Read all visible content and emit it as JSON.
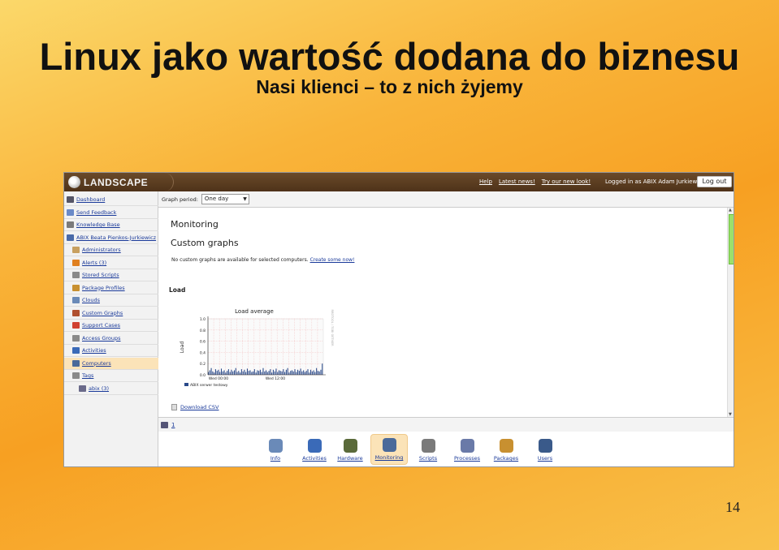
{
  "slide": {
    "title": "Linux jako wartość dodana do biznesu",
    "subtitle": "Nasi klienci – to z nich żyjemy",
    "page_number": "14"
  },
  "app": {
    "logo_text": "LANDSCAPE",
    "top_links": [
      "Help",
      "Latest news!",
      "Try our new look!"
    ],
    "logged_in": "Logged in as ABIX Adam Jurkiewicz",
    "logout_label": "Log out"
  },
  "sidebar": {
    "items": [
      {
        "label": "Dashboard",
        "icon": "dashboard-icon",
        "color": "#556"
      },
      {
        "label": "Send Feedback",
        "icon": "envelope-icon",
        "color": "#6a8ac8"
      },
      {
        "label": "Knowledge Base",
        "icon": "book-icon",
        "color": "#7a7a7a"
      },
      {
        "label": "ABIX Beata Pienkos-Jurkiewicz",
        "icon": "account-icon",
        "color": "#4a6aa8"
      },
      {
        "label": "Administrators",
        "icon": "admin-icon",
        "color": "#c8a060"
      },
      {
        "label": "Alerts (3)",
        "icon": "warning-icon",
        "color": "#e08020"
      },
      {
        "label": "Stored Scripts",
        "icon": "scripts-icon",
        "color": "#8a8a8a"
      },
      {
        "label": "Package Profiles",
        "icon": "package-icon",
        "color": "#c89030"
      },
      {
        "label": "Clouds",
        "icon": "cloud-icon",
        "color": "#6a8ab8"
      },
      {
        "label": "Custom Graphs",
        "icon": "graph-icon",
        "color": "#b05030"
      },
      {
        "label": "Support Cases",
        "icon": "lifebuoy-icon",
        "color": "#d04030"
      },
      {
        "label": "Access Groups",
        "icon": "groups-icon",
        "color": "#8a8a8a"
      },
      {
        "label": "Activities",
        "icon": "globe-icon",
        "color": "#3a6ab8"
      },
      {
        "label": "Computers",
        "icon": "computers-icon",
        "color": "#4a6a9a"
      },
      {
        "label": "Tags",
        "icon": "tag-icon",
        "color": "#8a8a8a"
      },
      {
        "label": "abix (3)",
        "icon": "tag-icon",
        "color": "#6a6a8a"
      }
    ],
    "active_index": 13
  },
  "main": {
    "graph_period_label": "Graph period:",
    "graph_period_value": "One day",
    "heading": "Monitoring",
    "custom_graphs_heading": "Custom graphs",
    "custom_graphs_note": "No custom graphs are available for selected computers.",
    "custom_graphs_link": "Create some now!",
    "load_heading": "Load",
    "download_label": "Download CSV",
    "pager_label": "1"
  },
  "chart_data": {
    "type": "bar",
    "title": "Load average",
    "xlabel": "",
    "ylabel": "Load",
    "ylim": [
      0,
      1.0
    ],
    "yticks": [
      "1.0",
      "0.8",
      "0.6",
      "0.4",
      "0.2",
      "0.0"
    ],
    "xticks": [
      "Wed 00:00",
      "Wed 12:00"
    ],
    "side_label": "RRDTOOL / TOBI OETIKER",
    "grid": true,
    "series": [
      {
        "name": "ABIX serwer testowy",
        "color": "#2a4a8a",
        "values": [
          0.05,
          0.08,
          0.12,
          0.06,
          0.04,
          0.1,
          0.07,
          0.09,
          0.05,
          0.11,
          0.06,
          0.08,
          0.04,
          0.07,
          0.1,
          0.05,
          0.09,
          0.06,
          0.08,
          0.12,
          0.05,
          0.07,
          0.04,
          0.1,
          0.06,
          0.09,
          0.05,
          0.11,
          0.07,
          0.08,
          0.05,
          0.06,
          0.1,
          0.04,
          0.08,
          0.07,
          0.09,
          0.05,
          0.12,
          0.06,
          0.08,
          0.05,
          0.07,
          0.1,
          0.04,
          0.09,
          0.06,
          0.11,
          0.05,
          0.08,
          0.07,
          0.06,
          0.1,
          0.05,
          0.09,
          0.12,
          0.04,
          0.07,
          0.08,
          0.06,
          0.1,
          0.05,
          0.09,
          0.07,
          0.11,
          0.06,
          0.08,
          0.05,
          0.07,
          0.1,
          0.04,
          0.09,
          0.06,
          0.08,
          0.05,
          0.12,
          0.07,
          0.06,
          0.09,
          0.2
        ]
      }
    ]
  },
  "tabs": [
    {
      "label": "Info",
      "icon": "lightbulb-icon",
      "color": "#6a8ab8"
    },
    {
      "label": "Activities",
      "icon": "globe-icon",
      "color": "#3a6ab8"
    },
    {
      "label": "Hardware",
      "icon": "hardware-icon",
      "color": "#5a6a3a"
    },
    {
      "label": "Monitoring",
      "icon": "monitoring-icon",
      "color": "#4a6a9a"
    },
    {
      "label": "Scripts",
      "icon": "scripts-icon",
      "color": "#7a7a7a"
    },
    {
      "label": "Processes",
      "icon": "gear-icon",
      "color": "#6a7aa8"
    },
    {
      "label": "Packages",
      "icon": "package-icon",
      "color": "#c89030"
    },
    {
      "label": "Users",
      "icon": "users-icon",
      "color": "#3a5a8a"
    }
  ],
  "active_tab": 3
}
